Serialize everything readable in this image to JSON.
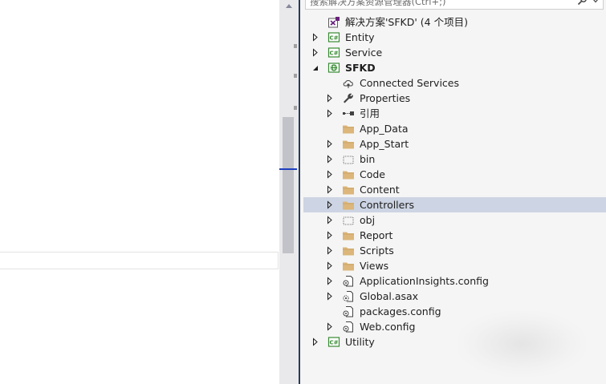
{
  "search": {
    "placeholder": "搜索解决方案资源管理器(Ctrl+;)"
  },
  "tree": [
    {
      "label": "解决方案'SFKD' (4 个项目)",
      "icon": "vs-solution-icon",
      "arrow": "none",
      "level": 0,
      "bold": false,
      "selected": false
    },
    {
      "label": "Entity",
      "icon": "csharp-project-icon",
      "arrow": "collapsed",
      "level": 0,
      "bold": false,
      "selected": false
    },
    {
      "label": "Service",
      "icon": "csharp-project-icon",
      "arrow": "collapsed",
      "level": 0,
      "bold": false,
      "selected": false
    },
    {
      "label": "SFKD",
      "icon": "web-project-icon",
      "arrow": "expanded",
      "level": 0,
      "bold": true,
      "selected": false
    },
    {
      "label": "Connected Services",
      "icon": "connected-services-icon",
      "arrow": "none",
      "level": 1,
      "bold": false,
      "selected": false
    },
    {
      "label": "Properties",
      "icon": "wrench-icon",
      "arrow": "collapsed",
      "level": 1,
      "bold": false,
      "selected": false
    },
    {
      "label": "引用",
      "icon": "references-icon",
      "arrow": "collapsed",
      "level": 1,
      "bold": false,
      "selected": false
    },
    {
      "label": "App_Data",
      "icon": "folder-icon",
      "arrow": "none",
      "level": 1,
      "bold": false,
      "selected": false
    },
    {
      "label": "App_Start",
      "icon": "folder-icon",
      "arrow": "collapsed",
      "level": 1,
      "bold": false,
      "selected": false
    },
    {
      "label": "bin",
      "icon": "dotted-folder-icon",
      "arrow": "collapsed",
      "level": 1,
      "bold": false,
      "selected": false
    },
    {
      "label": "Code",
      "icon": "folder-icon",
      "arrow": "collapsed",
      "level": 1,
      "bold": false,
      "selected": false
    },
    {
      "label": "Content",
      "icon": "folder-icon",
      "arrow": "collapsed",
      "level": 1,
      "bold": false,
      "selected": false
    },
    {
      "label": "Controllers",
      "icon": "folder-icon",
      "arrow": "collapsed",
      "level": 1,
      "bold": false,
      "selected": true
    },
    {
      "label": "obj",
      "icon": "dotted-folder-icon",
      "arrow": "collapsed",
      "level": 1,
      "bold": false,
      "selected": false
    },
    {
      "label": "Report",
      "icon": "folder-icon",
      "arrow": "collapsed",
      "level": 1,
      "bold": false,
      "selected": false
    },
    {
      "label": "Scripts",
      "icon": "folder-icon",
      "arrow": "collapsed",
      "level": 1,
      "bold": false,
      "selected": false
    },
    {
      "label": "Views",
      "icon": "folder-icon",
      "arrow": "collapsed",
      "level": 1,
      "bold": false,
      "selected": false
    },
    {
      "label": "ApplicationInsights.config",
      "icon": "config-file-icon",
      "arrow": "collapsed",
      "level": 1,
      "bold": false,
      "selected": false
    },
    {
      "label": "Global.asax",
      "icon": "gear-file-icon",
      "arrow": "collapsed",
      "level": 1,
      "bold": false,
      "selected": false
    },
    {
      "label": "packages.config",
      "icon": "config-file-icon",
      "arrow": "none",
      "level": 1,
      "bold": false,
      "selected": false
    },
    {
      "label": "Web.config",
      "icon": "config-file-icon",
      "arrow": "collapsed",
      "level": 1,
      "bold": false,
      "selected": false
    },
    {
      "label": "Utility",
      "icon": "csharp-project-icon",
      "arrow": "collapsed",
      "level": 0,
      "bold": false,
      "selected": false
    }
  ]
}
